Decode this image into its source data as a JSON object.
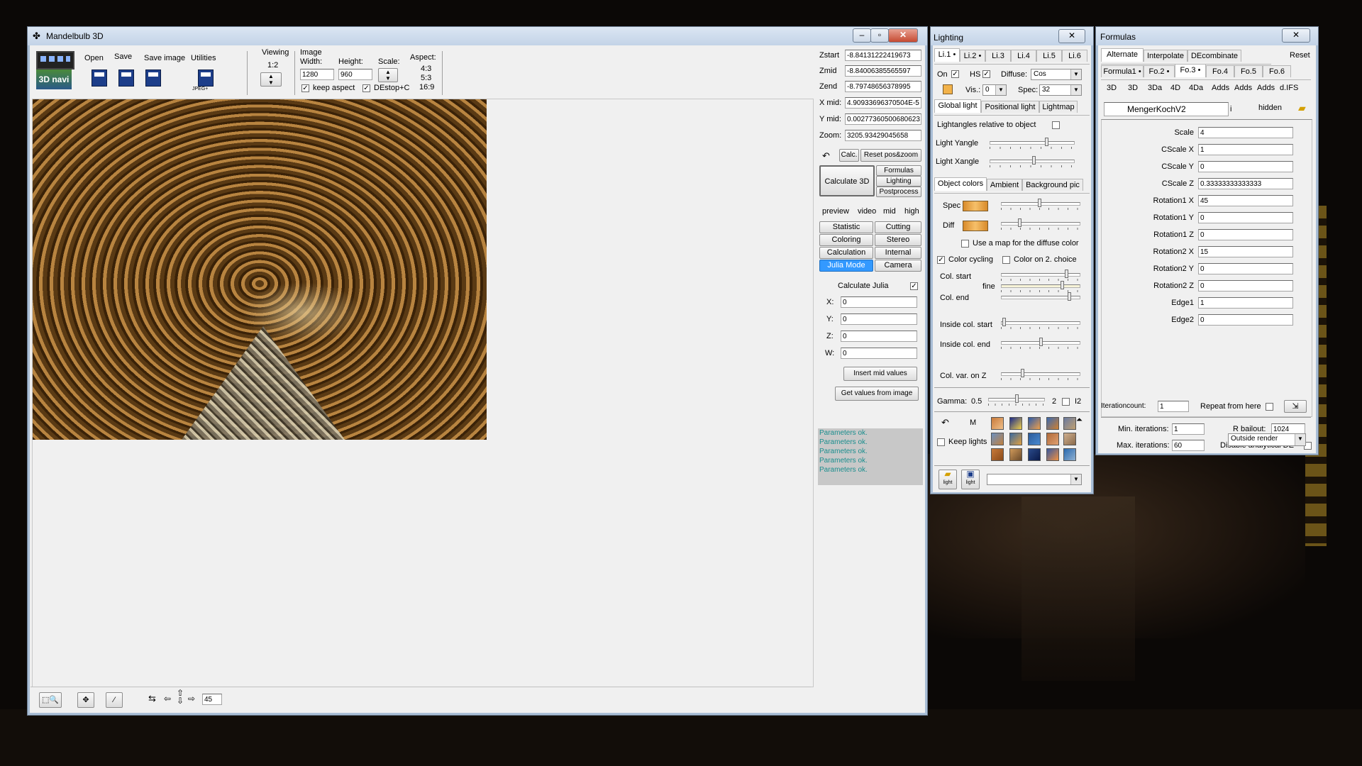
{
  "main_window": {
    "title": "Mandelbulb 3D",
    "menu": {
      "open": "Open",
      "save": "Save",
      "save_image": "Save image",
      "utilities": "Utilities"
    },
    "toolbar_icons": {
      "nav_3d": "3D navi",
      "jpeg_label": "JPEG+"
    },
    "viewing": {
      "label": "Viewing",
      "ratio": "1:2"
    },
    "image": {
      "label": "Image",
      "width_label": "Width:",
      "height_label": "Height:",
      "scale_label": "Scale:",
      "aspect_label": "Aspect:",
      "width": "1280",
      "height": "960",
      "aspects": [
        "4:3",
        "5:3",
        "16:9"
      ],
      "keep_aspect": "keep aspect",
      "destop": "DEstop+C"
    },
    "coords": [
      {
        "label": "Zstart",
        "value": "-8.84131222419673"
      },
      {
        "label": "Zmid",
        "value": "-8.84006385565597"
      },
      {
        "label": "Zend",
        "value": "-8.79748656378995"
      },
      {
        "label": "X mid:",
        "value": "4.90933696370504E-5"
      },
      {
        "label": "Y mid:",
        "value": "0.00277360500680623"
      },
      {
        "label": "Zoom:",
        "value": "3205.93429045658"
      }
    ],
    "calc_btn": "Calc.",
    "reset_btn": "Reset pos&zoom",
    "calculate_3d": "Calculate 3D",
    "side_btns": [
      "Formulas",
      "Lighting",
      "Postprocess"
    ],
    "quality": [
      "preview",
      "video",
      "mid",
      "high"
    ],
    "tabs_left": [
      "Statistic",
      "Coloring",
      "Calculation",
      "Julia Mode"
    ],
    "tabs_right": [
      "Cutting",
      "Stereo",
      "Internal",
      "Camera"
    ],
    "julia": {
      "calculate": "Calculate Julia",
      "fields": [
        {
          "label": "X:",
          "value": "0"
        },
        {
          "label": "Y:",
          "value": "0"
        },
        {
          "label": "Z:",
          "value": "0"
        },
        {
          "label": "W:",
          "value": "0"
        }
      ],
      "insert_mid": "Insert mid values",
      "get_values": "Get values from image"
    },
    "status": [
      "Parameters ok.",
      "Parameters ok.",
      "Parameters ok.",
      "Parameters ok.",
      "Parameters ok."
    ],
    "bottom": {
      "step": "45"
    }
  },
  "lighting": {
    "title": "Lighting",
    "light_tabs": [
      "Li.1 •",
      "Li.2 •",
      "Li.3",
      "Li.4",
      "Li.5",
      "Li.6"
    ],
    "on_label": "On",
    "hs_label": "HS",
    "diffuse_label": "Diffuse:",
    "diffuse_value": "Cos",
    "vis_label": "Vis.:",
    "vis_value": "0",
    "spec_label": "Spec:",
    "spec_value": "32",
    "sub_tabs": [
      "Global light",
      "Positional light",
      "Lightmap"
    ],
    "lightangles": "Lightangles relative to object",
    "light_yangle": "Light Yangle",
    "light_xangle": "Light Xangle",
    "color_tabs": [
      "Object colors",
      "Ambient",
      "Background pic"
    ],
    "spec": "Spec",
    "diff": "Diff",
    "use_map": "Use a map for the diffuse color",
    "color_cycling": "Color cycling",
    "color_on_2": "Color on 2. choice",
    "col_start": "Col. start",
    "fine": "fine",
    "col_end": "Col. end",
    "inside_start": "Inside col. start",
    "inside_end": "Inside col. end",
    "col_var": "Col. var. on Z",
    "gamma_label": "Gamma:",
    "gamma_value": "0.5",
    "gamma_2": "2",
    "gamma_i2": "I2",
    "m_label": "M",
    "keep_lights": "Keep lights",
    "light_icon_label": "light",
    "colors": {
      "swatch": "#e0a040"
    }
  },
  "formulas": {
    "title": "Formulas",
    "top_tabs": [
      "Alternate",
      "Interpolate",
      "DEcombinate"
    ],
    "reset": "Reset",
    "formula_tabs": [
      "Formula1 •",
      "Fo.2 •",
      "Fo.3 •",
      "Fo.4",
      "Fo.5",
      "Fo.6"
    ],
    "type_tabs": [
      "3D",
      "3D",
      "3Da",
      "4D",
      "4Da",
      "Adds",
      "Adds",
      "Adds",
      "d.IFS"
    ],
    "formula_name": "MengerKochV2",
    "info": "i",
    "hidden": "hidden",
    "params": [
      {
        "label": "Scale",
        "value": "4"
      },
      {
        "label": "CScale X",
        "value": "1"
      },
      {
        "label": "CScale Y",
        "value": "0"
      },
      {
        "label": "CScale Z",
        "value": "0.33333333333333"
      },
      {
        "label": "Rotation1 X",
        "value": "45"
      },
      {
        "label": "Rotation1 Y",
        "value": "0"
      },
      {
        "label": "Rotation1 Z",
        "value": "0"
      },
      {
        "label": "Rotation2 X",
        "value": "15"
      },
      {
        "label": "Rotation2 Y",
        "value": "0"
      },
      {
        "label": "Rotation2 Z",
        "value": "0"
      },
      {
        "label": "Edge1",
        "value": "1"
      },
      {
        "label": "Edge2",
        "value": "0"
      }
    ],
    "iterationcount_label": "Iterationcount:",
    "iterationcount": "1",
    "repeat_label": "Repeat from here",
    "min_iter_label": "Min. iterations:",
    "min_iter": "1",
    "max_iter_label": "Max. iterations:",
    "max_iter": "60",
    "rbailout_label": "R bailout:",
    "rbailout": "1024",
    "disable_de": "Disable analytical DE",
    "render_mode": "Outside render"
  }
}
